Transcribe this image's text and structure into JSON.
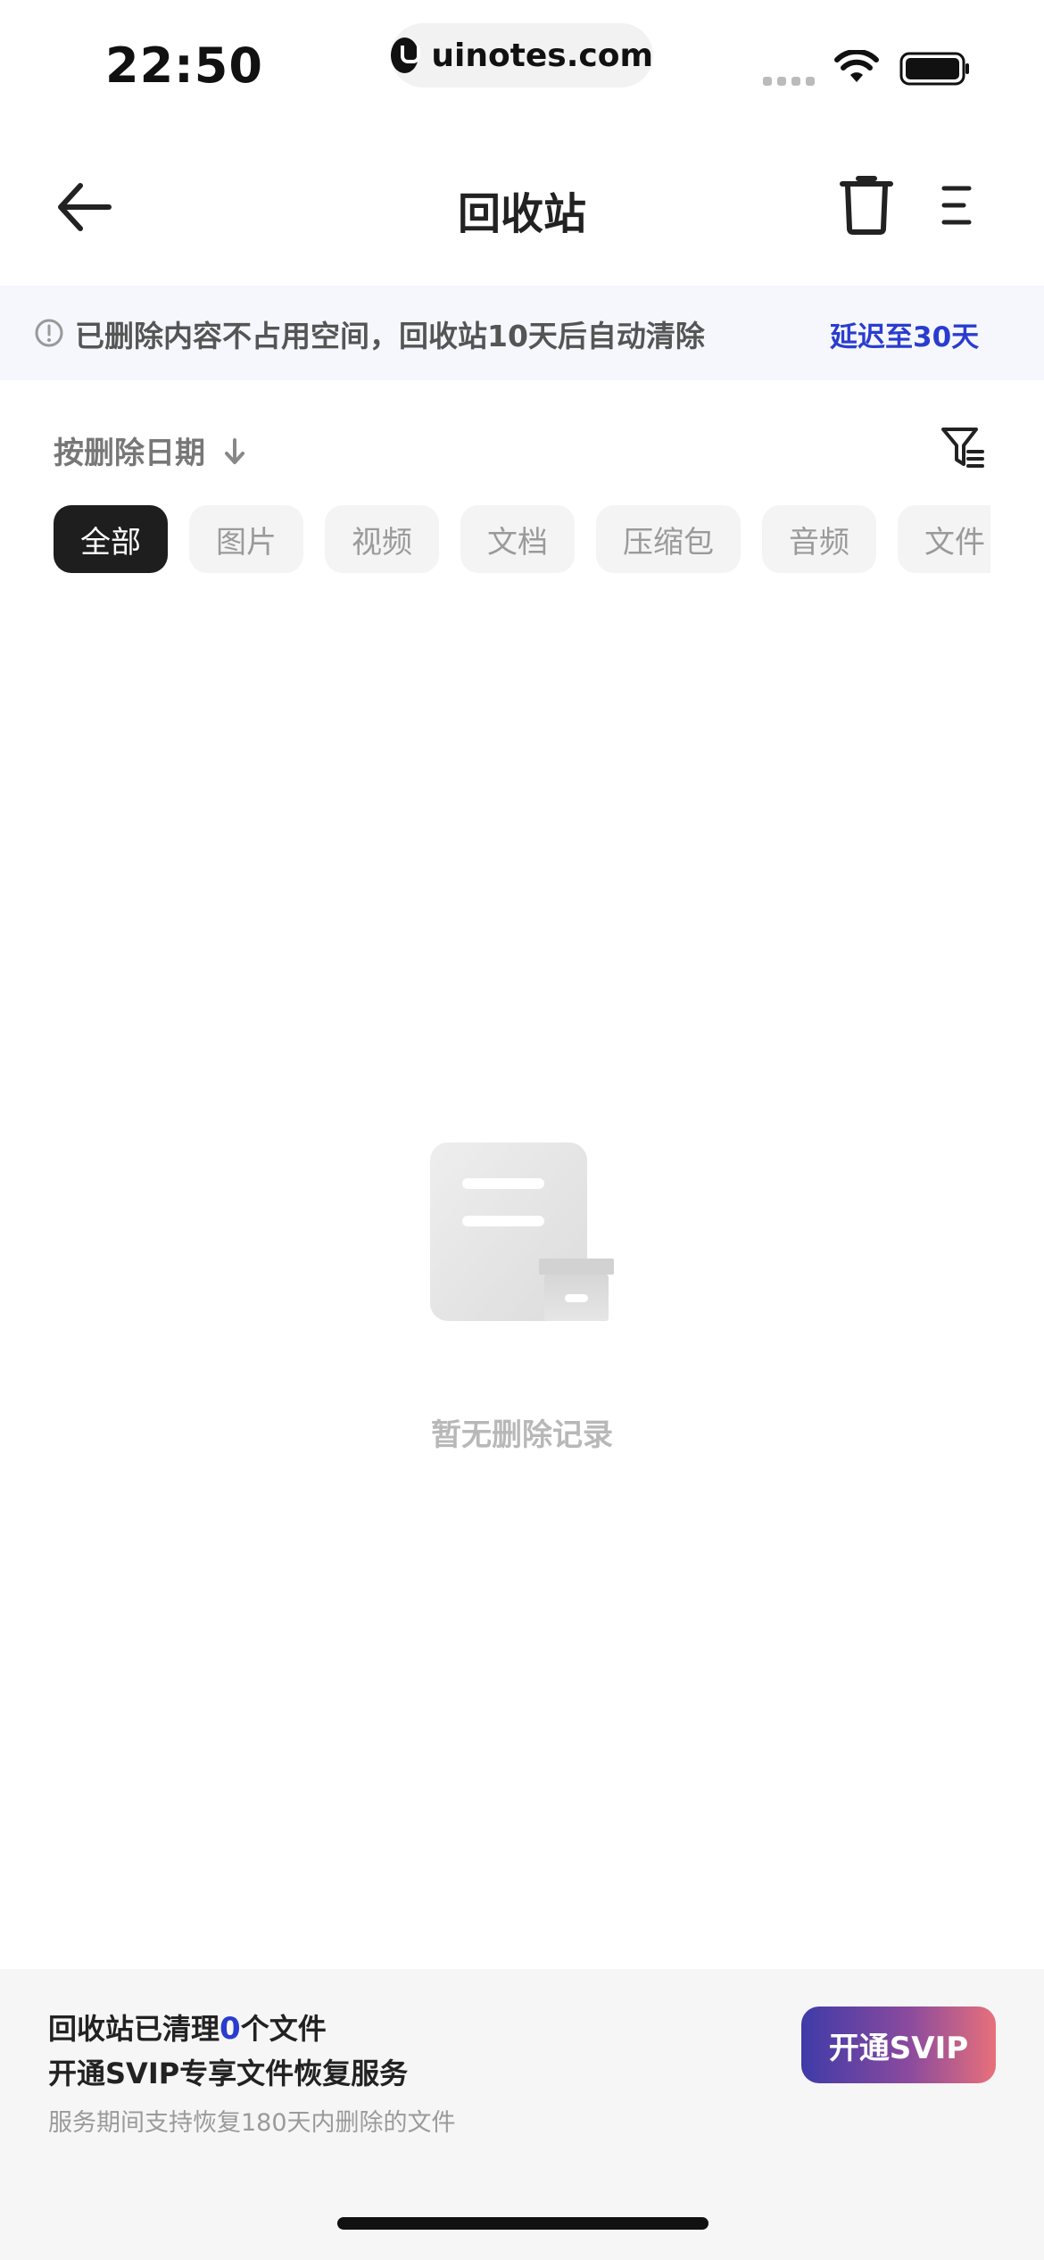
{
  "status_bar": {
    "time": "22:50",
    "url": "uinotes.com"
  },
  "nav": {
    "title": "回收站"
  },
  "notice": {
    "text": "已删除内容不占用空间，回收站10天后自动清除",
    "link": "延迟至30天"
  },
  "sort": {
    "label": "按删除日期"
  },
  "chips": [
    "全部",
    "图片",
    "视频",
    "文档",
    "压缩包",
    "音频",
    "文件"
  ],
  "empty": {
    "text": "暂无删除记录"
  },
  "promo": {
    "line1_prefix": "回收站已清理",
    "count": "0",
    "line1_suffix": "个文件",
    "line2": "开通SVIP专享文件恢复服务",
    "sub": "服务期间支持恢复180天内删除的文件",
    "button": "开通SVIP"
  },
  "colors": {
    "accent": "#2a3ccf",
    "chip_active_bg": "#1e1e1e",
    "notice_bg": "#f5f7fd",
    "promo_bg": "#f6f6f6"
  }
}
